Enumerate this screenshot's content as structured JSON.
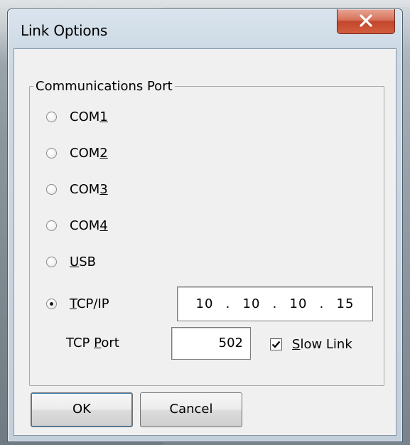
{
  "window": {
    "title": "Link Options"
  },
  "group": {
    "legend": "Communications Port",
    "radios": [
      {
        "prefix": "COM",
        "accel": "1",
        "suffix": "",
        "checked": false
      },
      {
        "prefix": "COM",
        "accel": "2",
        "suffix": "",
        "checked": false
      },
      {
        "prefix": "COM",
        "accel": "3",
        "suffix": "",
        "checked": false
      },
      {
        "prefix": "COM",
        "accel": "4",
        "suffix": "",
        "checked": false
      },
      {
        "prefix": "",
        "accel": "U",
        "suffix": "SB",
        "checked": false
      },
      {
        "prefix": "",
        "accel": "T",
        "suffix": "CP/IP",
        "checked": true
      }
    ],
    "ip": {
      "octets": [
        "10",
        "10",
        "10",
        "15"
      ],
      "separator": "."
    },
    "tcp_port": {
      "label_prefix": "TCP ",
      "label_accel": "P",
      "label_suffix": "ort",
      "value": "502"
    },
    "slow_link": {
      "accel": "S",
      "suffix": "low Link",
      "checked": true
    }
  },
  "buttons": {
    "ok": "OK",
    "cancel": "Cancel"
  },
  "icons": {
    "close": "close-icon",
    "check": "checkmark-icon"
  },
  "colors": {
    "close_button": "#c2462c",
    "default_button_focus": "#3c7fb1"
  }
}
